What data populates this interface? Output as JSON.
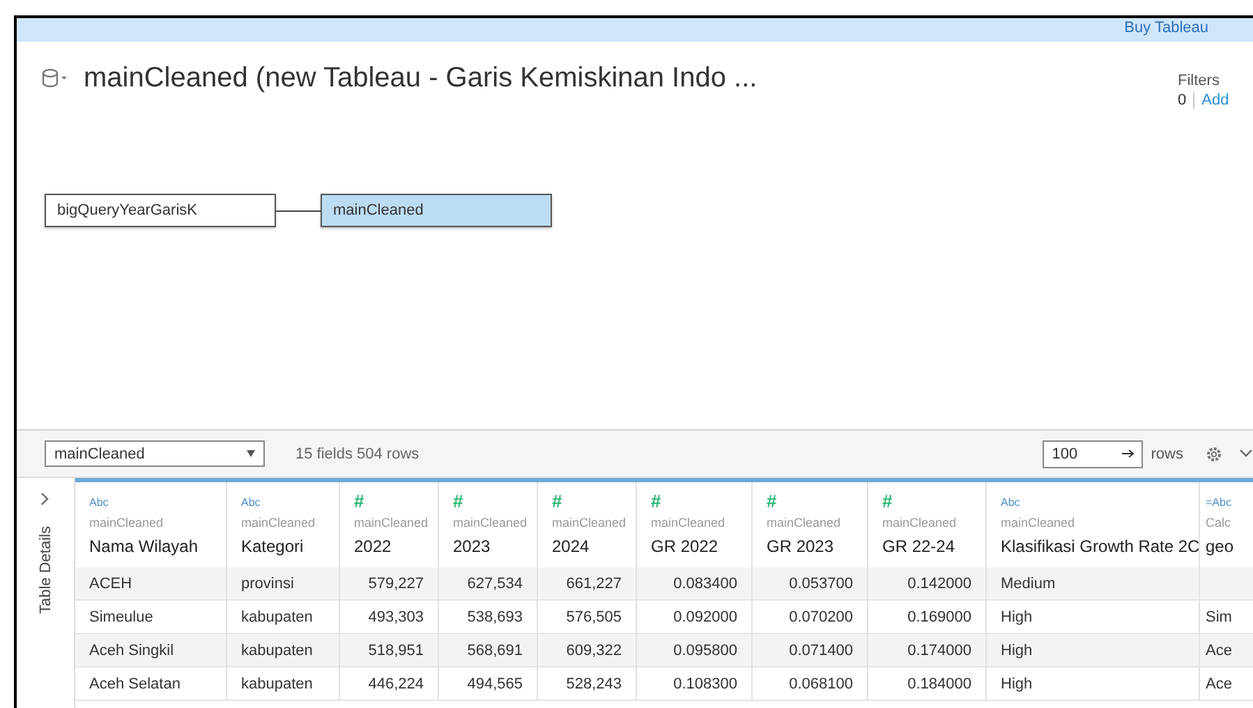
{
  "top_bar": {
    "link": "Buy Tableau"
  },
  "header": {
    "title": "mainCleaned (new Tableau - Garis Kemiskinan Indo ...",
    "filters": {
      "label": "Filters",
      "count": "0",
      "action": "Add"
    }
  },
  "canvas": {
    "nodes": [
      {
        "label": "bigQueryYearGarisK",
        "selected": false
      },
      {
        "label": "mainCleaned",
        "selected": true
      }
    ]
  },
  "toolbar": {
    "table_select": "mainCleaned",
    "summary": "15 fields 504 rows",
    "row_limit": "100",
    "rows_label": "rows"
  },
  "side_panel": {
    "label": "Table Details",
    "expanded": false
  },
  "table": {
    "columns": [
      {
        "kind": "string",
        "type_label": "Abc",
        "source": "mainCleaned",
        "name": "Nama Wilayah"
      },
      {
        "kind": "string",
        "type_label": "Abc",
        "source": "mainCleaned",
        "name": "Kategori"
      },
      {
        "kind": "number",
        "type_label": "#",
        "source": "mainCleaned",
        "name": "2022"
      },
      {
        "kind": "number",
        "type_label": "#",
        "source": "mainCleaned",
        "name": "2023"
      },
      {
        "kind": "number",
        "type_label": "#",
        "source": "mainCleaned",
        "name": "2024"
      },
      {
        "kind": "number",
        "type_label": "#",
        "source": "mainCleaned",
        "name": "GR 2022"
      },
      {
        "kind": "number",
        "type_label": "#",
        "source": "mainCleaned",
        "name": "GR 2023"
      },
      {
        "kind": "number",
        "type_label": "#",
        "source": "mainCleaned",
        "name": "GR 22-24"
      },
      {
        "kind": "string",
        "type_label": "Abc",
        "source": "mainCleaned",
        "name": "Klasifikasi Growth Rate 2C"
      },
      {
        "kind": "calc",
        "type_label": "=Abc",
        "source": "Calc",
        "name": "geo"
      }
    ],
    "rows": [
      [
        "ACEH",
        "provinsi",
        "579,227",
        "627,534",
        "661,227",
        "0.083400",
        "0.053700",
        "0.142000",
        "Medium",
        ""
      ],
      [
        "Simeulue",
        "kabupaten",
        "493,303",
        "538,693",
        "576,505",
        "0.092000",
        "0.070200",
        "0.169000",
        "High",
        "Sim"
      ],
      [
        "Aceh Singkil",
        "kabupaten",
        "518,951",
        "568,691",
        "609,322",
        "0.095800",
        "0.071400",
        "0.174000",
        "High",
        "Ace"
      ],
      [
        "Aceh Selatan",
        "kabupaten",
        "446,224",
        "494,565",
        "528,243",
        "0.108300",
        "0.068100",
        "0.184000",
        "High",
        "Ace"
      ]
    ]
  }
}
